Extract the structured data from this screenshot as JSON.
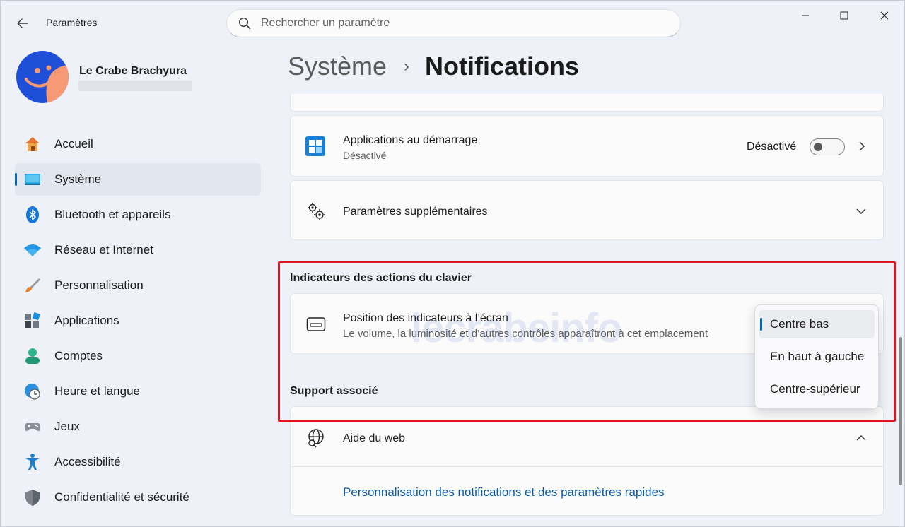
{
  "window": {
    "title": "Paramètres",
    "controls": [
      "minimize",
      "maximize",
      "close"
    ]
  },
  "search": {
    "placeholder": "Rechercher un paramètre"
  },
  "profile": {
    "name": "Le Crabe Brachyura"
  },
  "nav": {
    "items": [
      {
        "label": "Accueil",
        "icon": "home-icon"
      },
      {
        "label": "Système",
        "icon": "system-icon",
        "active": true
      },
      {
        "label": "Bluetooth et appareils",
        "icon": "bluetooth-icon"
      },
      {
        "label": "Réseau et Internet",
        "icon": "wifi-icon"
      },
      {
        "label": "Personnalisation",
        "icon": "brush-icon"
      },
      {
        "label": "Applications",
        "icon": "apps-icon"
      },
      {
        "label": "Comptes",
        "icon": "account-icon"
      },
      {
        "label": "Heure et langue",
        "icon": "clock-globe-icon"
      },
      {
        "label": "Jeux",
        "icon": "gamepad-icon"
      },
      {
        "label": "Accessibilité",
        "icon": "accessibility-icon"
      },
      {
        "label": "Confidentialité et sécurité",
        "icon": "shield-icon"
      }
    ]
  },
  "breadcrumb": {
    "parent": "Système",
    "separator": "›",
    "current": "Notifications"
  },
  "cards": {
    "startup": {
      "title": "Applications au démarrage",
      "subtitle": "Désactivé",
      "state_label": "Désactivé"
    },
    "additional": {
      "title": "Paramètres supplémentaires"
    }
  },
  "keyboard_section": {
    "title": "Indicateurs des actions du clavier",
    "position": {
      "title": "Position des indicateurs à l’écran",
      "subtitle": "Le volume, la luminosité et d’autres contrôles apparaîtront à cet emplacement"
    },
    "dropdown": {
      "options": [
        "Centre bas",
        "En haut à gauche",
        "Centre-supérieur"
      ],
      "selected": "Centre bas"
    }
  },
  "support_section": {
    "title": "Support associé",
    "web_help": {
      "title": "Aide du web"
    },
    "link": "Personnalisation des notifications et des paramètres rapides"
  },
  "watermark": "lecrabeinfo",
  "colors": {
    "accent": "#0067c0",
    "highlight": "#e3121f",
    "link": "#0a5bab"
  }
}
